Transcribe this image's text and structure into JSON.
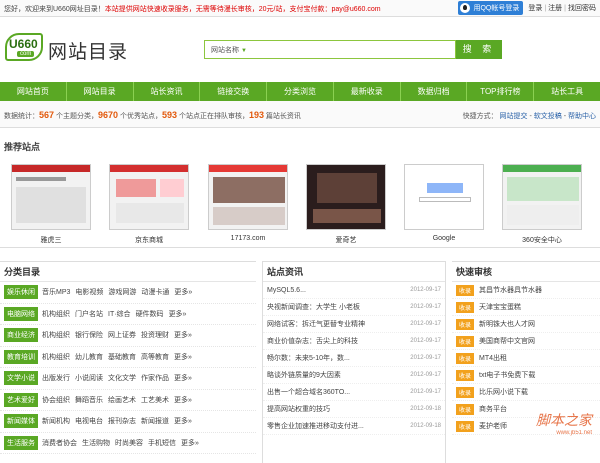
{
  "topbar": {
    "welcome_prefix": "您好，欢迎来到U660网址目录！",
    "welcome_notice": "本站提供网站快速收录服务，无需等待漫长审核，20元/站，支付宝付款：pay@u660.com",
    "qq_login": "用QQ帐号登录",
    "login": "登录",
    "register": "注册",
    "find_password": "找回密码"
  },
  "header": {
    "logo_text": "U660",
    "logo_sub": "com",
    "site_title": "网站目录",
    "search_select": "网站名称",
    "search_button": "搜 索"
  },
  "nav": {
    "items": [
      {
        "label": "网站首页"
      },
      {
        "label": "网站目录"
      },
      {
        "label": "站长资讯"
      },
      {
        "label": "链接交换"
      },
      {
        "label": "分类浏览"
      },
      {
        "label": "最新收录"
      },
      {
        "label": "数据归档"
      },
      {
        "label": "TOP排行榜"
      },
      {
        "label": "站长工具"
      }
    ]
  },
  "stats": {
    "prefix": "数据统计：",
    "cat_count": "567",
    "cat_label": " 个主题分类，",
    "site_count": "9670",
    "site_label": " 个优秀站点，",
    "pending_count": "593",
    "pending_label": " 个站点正在排队审核，",
    "news_count": "193",
    "news_label": " 篇站长资讯",
    "shortcut_label": "快捷方式：",
    "shortcut_submit": "网站提交",
    "shortcut_post": "软文投稿",
    "shortcut_help": "帮助中心"
  },
  "recommend": {
    "title": "推荐站点",
    "sites": [
      {
        "name": "雅虎三",
        "color": "#c62828"
      },
      {
        "name": "京东商城",
        "color": "#d32f2f"
      },
      {
        "name": "17173.com",
        "color": "#e53935"
      },
      {
        "name": "爱奇艺",
        "color": "#3a2a2a"
      },
      {
        "name": "Google",
        "color": "#ffffff"
      },
      {
        "name": "360安全中心",
        "color": "#4caf50"
      }
    ]
  },
  "categories": {
    "title": "分类目录",
    "more": "更多»",
    "rows": [
      {
        "tag": "娱乐休闲",
        "links": [
          "音乐MP3",
          "电影视频",
          "游戏网游",
          "动漫卡通"
        ]
      },
      {
        "tag": "电脑网络",
        "links": [
          "机构组织",
          "门户名站",
          "IT·综合",
          "硬件数码"
        ]
      },
      {
        "tag": "商业经济",
        "links": [
          "机构组织",
          "银行保险",
          "网上证券",
          "投资理财"
        ]
      },
      {
        "tag": "教育培训",
        "links": [
          "机构组织",
          "幼儿教育",
          "基础教育",
          "高等教育"
        ]
      },
      {
        "tag": "文学小说",
        "links": [
          "出版发行",
          "小说阅读",
          "文化文学",
          "作家作品"
        ]
      },
      {
        "tag": "艺术爱好",
        "links": [
          "协会组织",
          "舞蹈音乐",
          "绘画艺术",
          "工艺美术"
        ]
      },
      {
        "tag": "新闻媒体",
        "links": [
          "新闻机构",
          "电视电台",
          "报刊杂志",
          "新闻报道"
        ]
      },
      {
        "tag": "生活服务",
        "links": [
          "消费者协会",
          "生活购物",
          "时尚美容",
          "手机短信"
        ]
      }
    ]
  },
  "news": {
    "title": "站点资讯",
    "items": [
      {
        "title": "MySQL5.6...",
        "date": "2012-09-17"
      },
      {
        "title": "央视新闻调查：大学生 小老板",
        "date": "2012-09-17"
      },
      {
        "title": "网络试客：拆迁气更替专业精神",
        "date": "2012-09-17"
      },
      {
        "title": "商业价值杂志：舌尖上的科技",
        "date": "2012-09-17"
      },
      {
        "title": "畅尔数：未来5-10年，数...",
        "date": "2012-09-17"
      },
      {
        "title": "略谈外链质量的9大因素",
        "date": "2012-09-17"
      },
      {
        "title": "出售一个超合域名360TO...",
        "date": "2012-09-17"
      },
      {
        "title": "提高网站权重的技巧",
        "date": "2012-09-18"
      },
      {
        "title": "零售企业加速推进移动支付进...",
        "date": "2012-09-18"
      }
    ]
  },
  "audit": {
    "title": "快速审核",
    "tag": "收录",
    "items": [
      {
        "name": "其昌节水器具节水器"
      },
      {
        "name": "天津宝宝蛋糕"
      },
      {
        "name": "新明铢大也人才网"
      },
      {
        "name": "美国商帮中文官网"
      },
      {
        "name": "MT4出租"
      },
      {
        "name": "txt电子书免费下载"
      },
      {
        "name": "比乐网小说下载"
      },
      {
        "name": "商务平台"
      },
      {
        "name": "麦护老师"
      }
    ]
  },
  "watermark": {
    "main": "脚本之家",
    "url": "www.jb51.net"
  }
}
